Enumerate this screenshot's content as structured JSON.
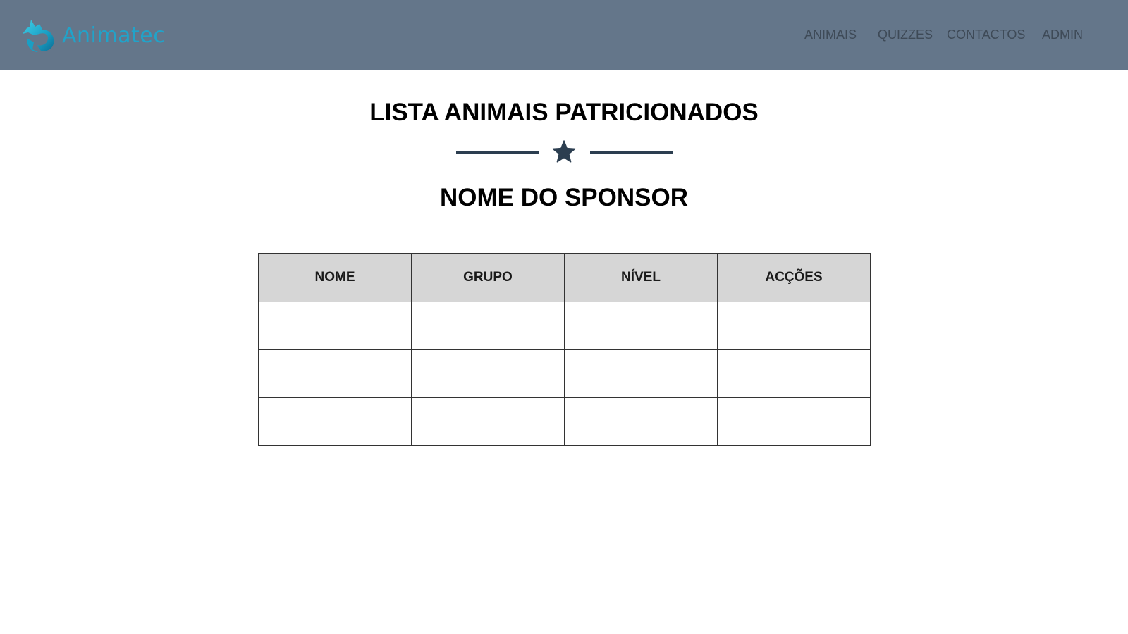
{
  "app": {
    "brand_name": "Animatec",
    "brand_logo_icon": "wolf-head-icon",
    "brand_color": "#21a3c9",
    "navbar_color": "#64768a"
  },
  "nav": {
    "items": [
      {
        "label": "ANIMAIS"
      },
      {
        "label": "QUIZZES"
      },
      {
        "label": "CONTACTOS"
      },
      {
        "label": "ADMIN"
      }
    ]
  },
  "main": {
    "title": "LISTA ANIMAIS PATRICIONADOS",
    "divider_icon": "star-icon",
    "sponsor_name": "NOME DO SPONSOR"
  },
  "table": {
    "columns": [
      "NOME",
      "GRUPO",
      "NÍVEL",
      "ACÇÕES"
    ],
    "rows": [
      [
        "",
        "",
        "",
        ""
      ],
      [
        "",
        "",
        "",
        ""
      ],
      [
        "",
        "",
        "",
        ""
      ]
    ]
  }
}
